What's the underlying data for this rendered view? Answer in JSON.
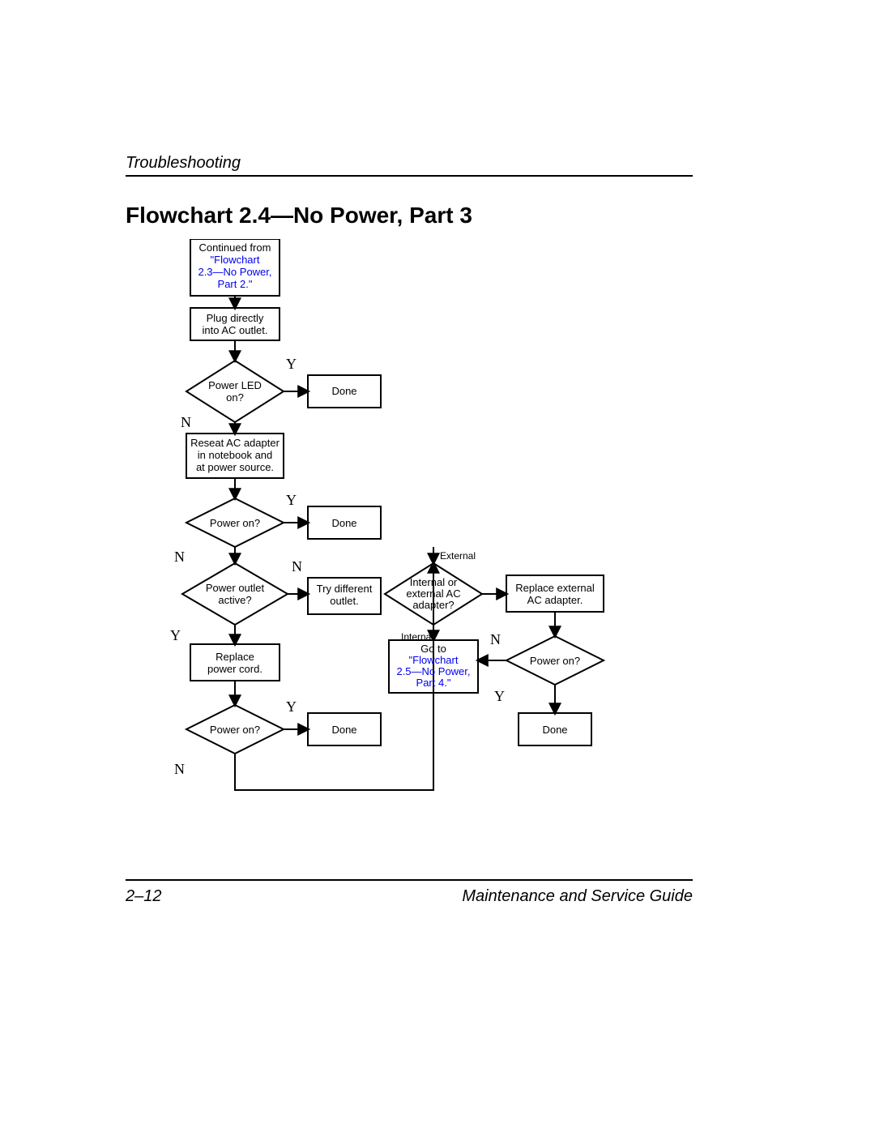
{
  "header": {
    "section": "Troubleshooting"
  },
  "title": "Flowchart 2.4—No Power, Part 3",
  "footer": {
    "page": "2–12",
    "book": "Maintenance and Service Guide"
  },
  "nodes": {
    "cont1": "Continued from",
    "cont_link1": "\"Flowchart",
    "cont_link2": "2.3—No Power,",
    "cont_link3": "Part 2.\"",
    "plug1": "Plug directly",
    "plug2": "into AC outlet.",
    "led1": "Power LED",
    "led2": "on?",
    "done1": "Done",
    "reseat1": "Reseat AC adapter",
    "reseat2": "in notebook and",
    "reseat3": "at power source.",
    "pon1": "Power on?",
    "done2": "Done",
    "outlet1": "Power outlet",
    "outlet2": "active?",
    "try1": "Try different",
    "try2": "outlet.",
    "replace1": "Replace",
    "replace2": "power cord.",
    "pon2": "Power on?",
    "done3": "Done",
    "adapter1": "Internal or",
    "adapter2": "external AC",
    "adapter3": "adapter?",
    "repext1": "Replace external",
    "repext2": "AC adapter.",
    "goto1": "Go to",
    "goto_link1": "\"Flowchart",
    "goto_link2": "2.5—No Power,",
    "goto_link3": "Part 4.\"",
    "pon3": "Power on?",
    "done4": "Done"
  },
  "labels": {
    "Y": "Y",
    "N": "N",
    "external": "External",
    "internal": "Internal"
  }
}
